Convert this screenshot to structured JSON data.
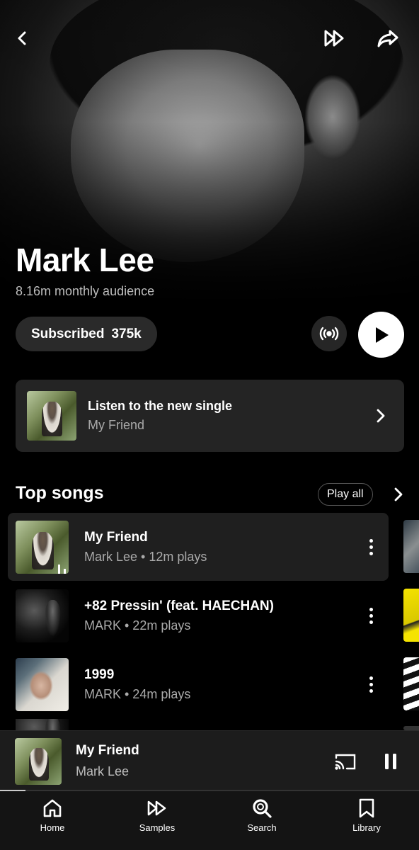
{
  "artist": {
    "name": "Mark Lee",
    "audience": "8.16m monthly audience"
  },
  "subscribe": {
    "label": "Subscribed",
    "count": "375k"
  },
  "single_promo": {
    "title": "Listen to the new single",
    "subtitle": "My Friend"
  },
  "top_songs": {
    "title": "Top songs",
    "play_all_label": "Play all",
    "songs": [
      {
        "title": "My Friend",
        "subtitle": "Mark Lee • 12m plays",
        "playing": true
      },
      {
        "title": "+82 Pressin' (feat. HAECHAN)",
        "subtitle": "MARK • 22m plays"
      },
      {
        "title": "1999",
        "subtitle": "MARK • 24m plays"
      }
    ]
  },
  "now_playing": {
    "title": "My Friend",
    "artist": "Mark Lee",
    "progress": 0.06
  },
  "nav": {
    "items": [
      {
        "label": "Home",
        "icon": "home-icon"
      },
      {
        "label": "Samples",
        "icon": "samples-icon"
      },
      {
        "label": "Search",
        "icon": "search-icon"
      },
      {
        "label": "Library",
        "icon": "library-icon"
      }
    ]
  },
  "icons": {
    "back": "back-icon",
    "queue": "queue-icon",
    "share": "share-icon",
    "radio": "radio-icon",
    "play": "play-icon",
    "chevron": "chevron-right-icon",
    "more": "more-icon",
    "cast": "cast-icon",
    "pause": "pause-icon"
  },
  "colors": {
    "background": "#000000",
    "card": "#242424",
    "accent": "#ffffff",
    "secondary_text": "#aaaaaa"
  }
}
